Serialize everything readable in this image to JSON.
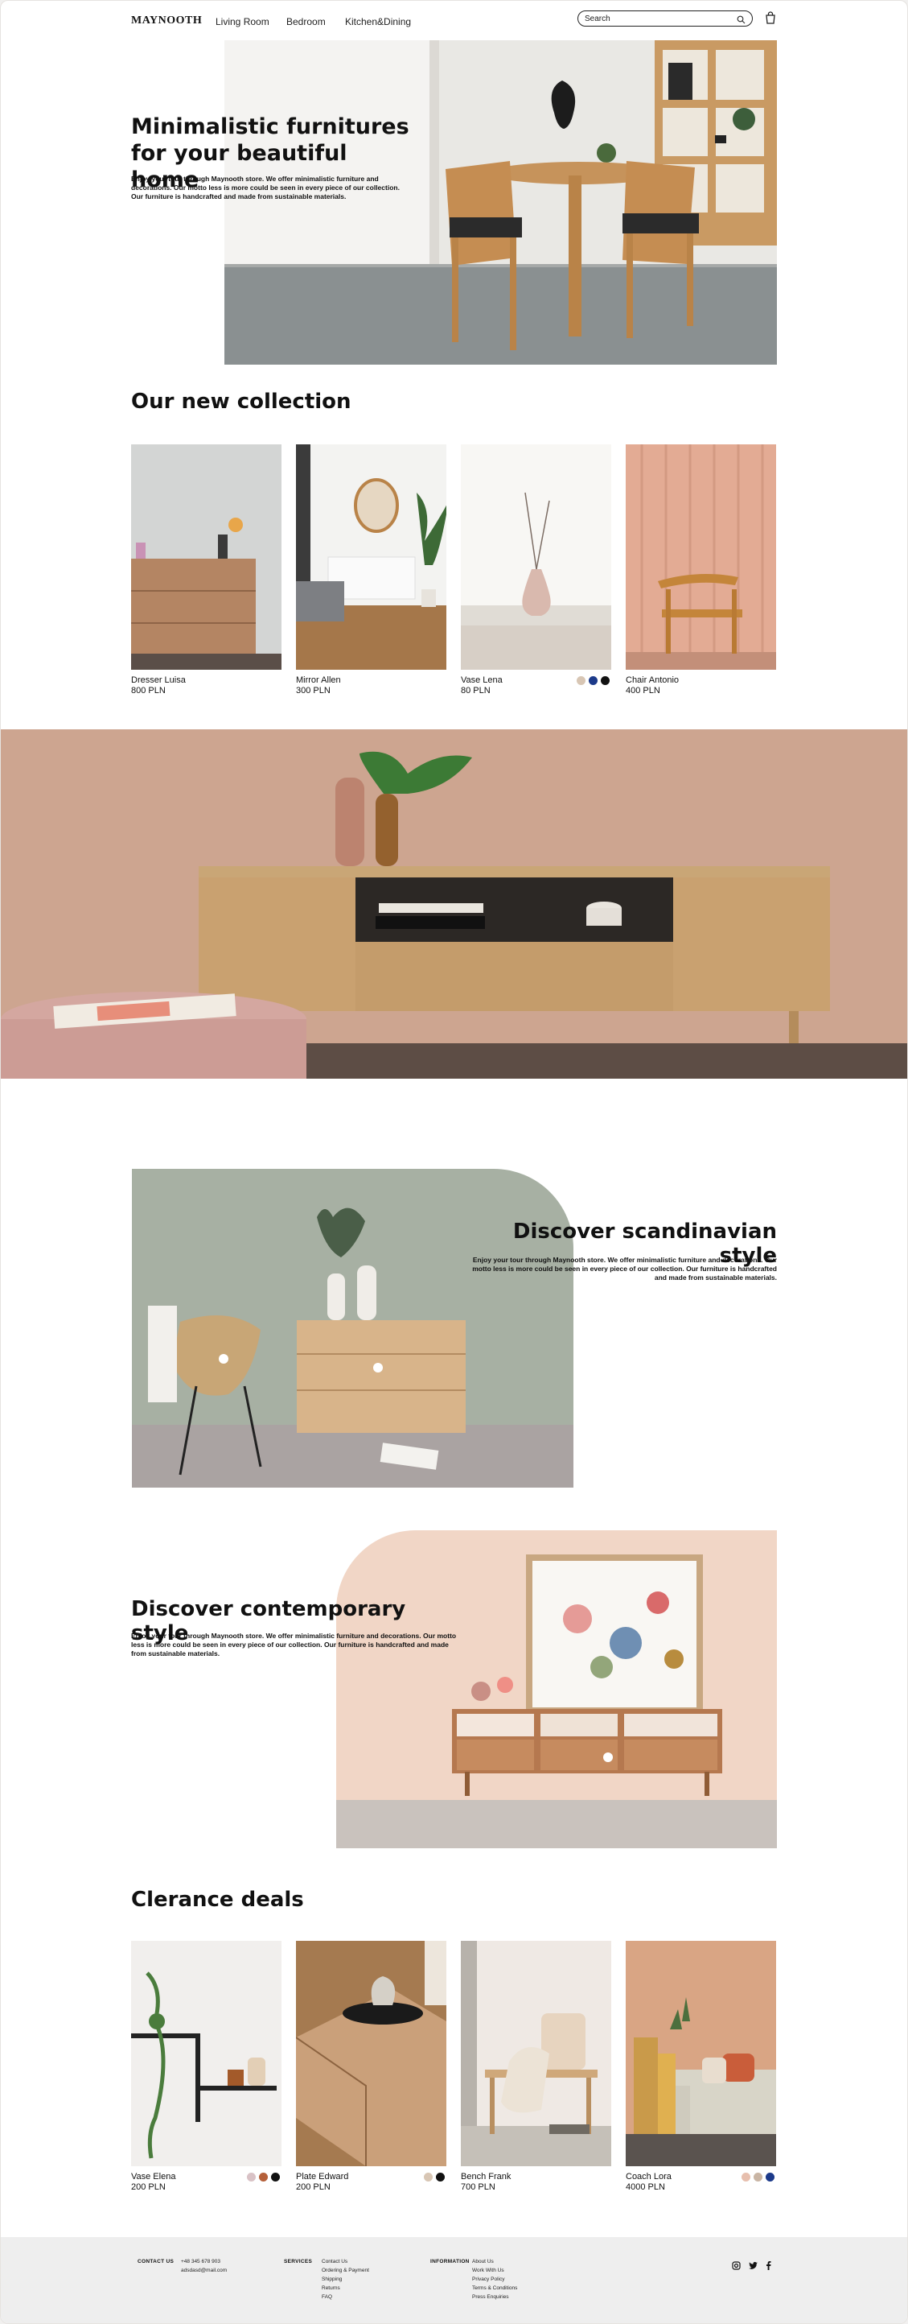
{
  "header": {
    "logo": "MAYNOOTH",
    "nav": [
      "Living Room",
      "Bedroom",
      "Kitchen&Dining"
    ],
    "search_placeholder": "Search"
  },
  "hero": {
    "title": "Minimalistic furnitures for your beautiful home",
    "text": "Enjoy your tour through Maynooth store. We offer minimalistic furniture and decorations. Our motto less is more could be seen in every piece of our collection. Our furniture is handcrafted and made from sustainable materials."
  },
  "new_collection": {
    "title": "Our new collection",
    "products": [
      {
        "name": "Dresser Luisa",
        "price": "800 PLN",
        "swatches": []
      },
      {
        "name": "Mirror Allen",
        "price": "300 PLN",
        "swatches": []
      },
      {
        "name": "Vase Lena",
        "price": "80 PLN",
        "swatches": [
          "#d8c6b4",
          "#1c3a8a",
          "#111111"
        ]
      },
      {
        "name": "Chair Antonio",
        "price": "400 PLN",
        "swatches": []
      }
    ]
  },
  "scandinavian": {
    "title": "Discover scandinavian style",
    "text": "Enjoy your tour through Maynooth store. We offer minimalistic furniture and decorations. Our motto less is more could be seen in every piece of our collection. Our furniture is handcrafted and made from sustainable materials."
  },
  "contemporary": {
    "title": "Discover contemporary style",
    "text": "Enjoy your tour through Maynooth store. We offer minimalistic furniture and decorations. Our motto less is more could be seen in every piece of our collection. Our furniture is handcrafted and made from sustainable materials."
  },
  "clearance": {
    "title": "Clerance deals",
    "products": [
      {
        "name": "Vase Elena",
        "price": "200 PLN",
        "swatches": [
          "#d9c2c6",
          "#b5603a",
          "#111111"
        ]
      },
      {
        "name": "Plate Edward",
        "price": "200 PLN",
        "swatches": [
          "#d8c6b4",
          "#111111"
        ]
      },
      {
        "name": "Bench Frank",
        "price": "700 PLN",
        "swatches": []
      },
      {
        "name": "Coach Lora",
        "price": "4000 PLN",
        "swatches": [
          "#e7bfae",
          "#c9b5a4",
          "#1c3a8a"
        ]
      }
    ]
  },
  "footer": {
    "contact": {
      "heading": "CONTACT US",
      "items": [
        "+48 345 678 903",
        "adsdasd@mail.com"
      ]
    },
    "services": {
      "heading": "SERVICES",
      "items": [
        "Contact Us",
        "Ordering & Payment",
        "Shipping",
        "Returns",
        "FAQ"
      ]
    },
    "information": {
      "heading": "INFORMATION",
      "items": [
        "About Us",
        "Work With Us",
        "Privacy Policy",
        "Terms & Conditions",
        "Press Enquiries"
      ]
    }
  },
  "icons": [
    "search-icon",
    "cart-icon",
    "instagram-icon",
    "twitter-icon",
    "facebook-icon"
  ]
}
